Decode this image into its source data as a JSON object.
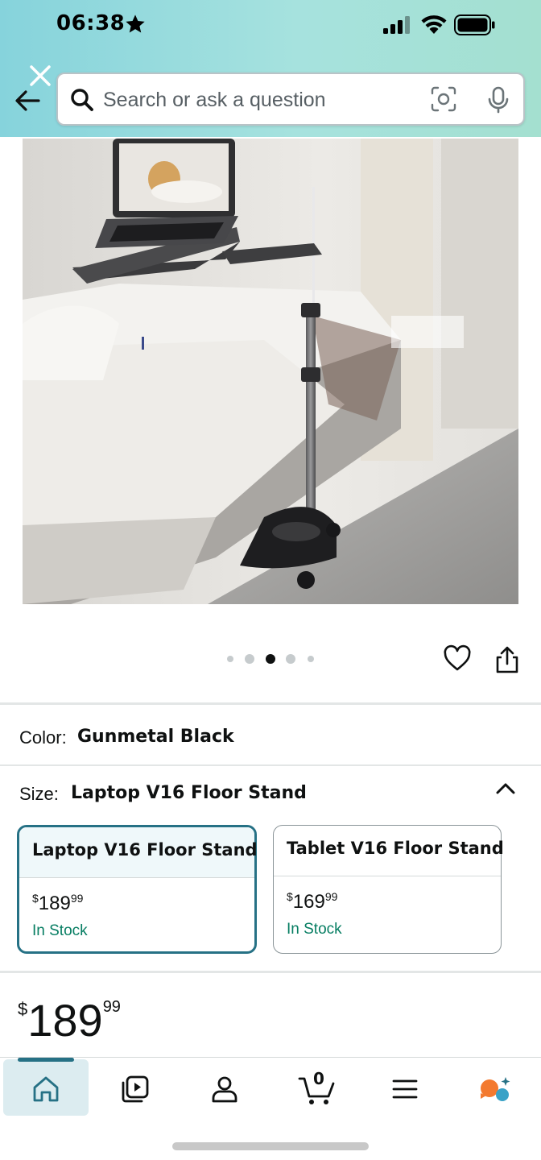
{
  "status_bar": {
    "time": "06:38"
  },
  "search": {
    "placeholder": "Search or ask a question"
  },
  "carousel": {
    "dot_count": 5,
    "active_index": 2
  },
  "color_row": {
    "label": "Color:",
    "value": "Gunmetal Black"
  },
  "size_row": {
    "label": "Size:",
    "value": "Laptop V16 Floor Stand"
  },
  "size_options": [
    {
      "title": "Laptop V16 Floor Stand",
      "currency": "$",
      "whole": "189",
      "fraction": "99",
      "stock": "In Stock",
      "selected": true
    },
    {
      "title": "Tablet V16 Floor Stand",
      "currency": "$",
      "whole": "169",
      "fraction": "99",
      "stock": "In Stock",
      "selected": false
    }
  ],
  "price": {
    "currency": "$",
    "whole": "189",
    "fraction": "99"
  },
  "cart": {
    "count": "0"
  },
  "bottom_nav": [
    "home",
    "video",
    "account",
    "cart",
    "menu",
    "assistant"
  ],
  "colors": {
    "accent": "#267185",
    "in_stock": "#067d62",
    "header_start": "#86d3dc",
    "header_end": "#a4e0d0"
  }
}
